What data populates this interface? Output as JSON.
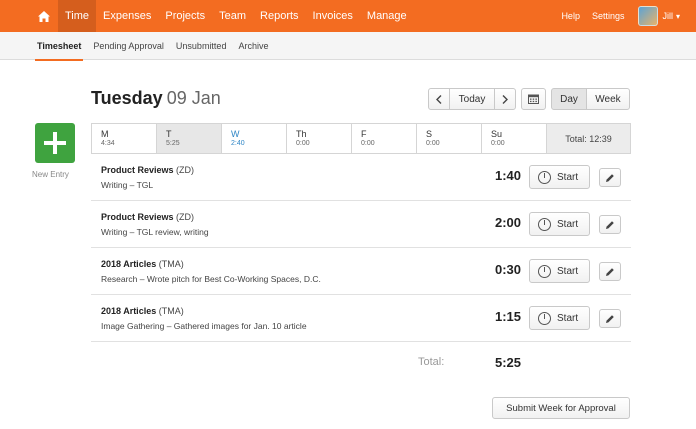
{
  "topnav": {
    "home_icon": "home-icon",
    "items": [
      {
        "label": "Time"
      },
      {
        "label": "Expenses"
      },
      {
        "label": "Projects"
      },
      {
        "label": "Team"
      },
      {
        "label": "Reports"
      },
      {
        "label": "Invoices"
      },
      {
        "label": "Manage"
      }
    ],
    "help": "Help",
    "settings": "Settings",
    "user": "Jill",
    "accent": "#f36c21"
  },
  "subnav": {
    "items": [
      {
        "label": "Timesheet"
      },
      {
        "label": "Pending Approval"
      },
      {
        "label": "Unsubmitted"
      },
      {
        "label": "Archive"
      }
    ]
  },
  "header": {
    "day": "Tuesday",
    "date": "09 Jan",
    "today_label": "Today",
    "day_label": "Day",
    "week_label": "Week"
  },
  "new_entry": {
    "label": "New Entry",
    "color": "#3fa33f"
  },
  "week": {
    "days": [
      {
        "name": "M",
        "time": "4:34"
      },
      {
        "name": "T",
        "time": "5:25"
      },
      {
        "name": "W",
        "time": "2:40"
      },
      {
        "name": "Th",
        "time": "0:00"
      },
      {
        "name": "F",
        "time": "0:00"
      },
      {
        "name": "S",
        "time": "0:00"
      },
      {
        "name": "Su",
        "time": "0:00"
      }
    ],
    "total": "Total: 12:39"
  },
  "entries": [
    {
      "project": "Product Reviews",
      "client": "(ZD)",
      "task": "Writing",
      "notes": "TGL",
      "duration": "1:40",
      "start_label": "Start"
    },
    {
      "project": "Product Reviews",
      "client": "(ZD)",
      "task": "Writing",
      "notes": "TGL review, writing",
      "duration": "2:00",
      "start_label": "Start"
    },
    {
      "project": "2018 Articles",
      "client": "(TMA)",
      "task": "Research",
      "notes": "Wrote pitch for Best Co-Working Spaces, D.C.",
      "duration": "0:30",
      "start_label": "Start"
    },
    {
      "project": "2018 Articles",
      "client": "(TMA)",
      "task": "Image Gathering",
      "notes": "Gathered images for Jan. 10 article",
      "duration": "1:15",
      "start_label": "Start"
    }
  ],
  "footer": {
    "total_label": "Total:",
    "total_value": "5:25",
    "submit_label": "Submit Week for Approval"
  }
}
